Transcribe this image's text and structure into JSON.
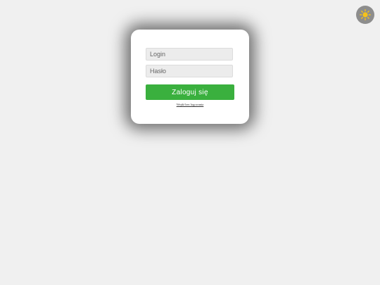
{
  "theme_toggle": {
    "icon": "sun-icon",
    "color": "#f5c21b"
  },
  "login_form": {
    "login_placeholder": "Login",
    "login_value": "",
    "password_placeholder": "Hasło",
    "password_value": "",
    "submit_label": "Zaloguj się",
    "guest_link_label": "Wejdź bez logowania"
  },
  "colors": {
    "background": "#f0f0f0",
    "card": "#ffffff",
    "accent": "#3ab03e"
  }
}
